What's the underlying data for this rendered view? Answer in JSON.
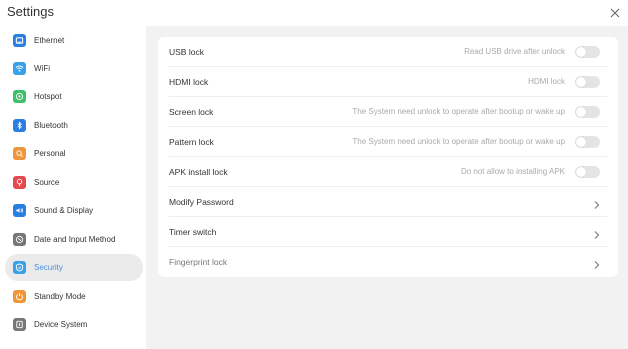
{
  "window": {
    "title": "Settings"
  },
  "colors": {
    "accent": "#4a90d9",
    "toggle_off": "#e4e4e4",
    "panel_bg": "#f2f2f2"
  },
  "sidebar": {
    "items": [
      {
        "label": "Ethernet",
        "icon": "ethernet-icon",
        "color": "#2a7de1"
      },
      {
        "label": "WiFi",
        "icon": "wifi-icon",
        "color": "#3aa0e8"
      },
      {
        "label": "Hotspot",
        "icon": "hotspot-icon",
        "color": "#3fbf6a"
      },
      {
        "label": "Bluetooth",
        "icon": "bluetooth-icon",
        "color": "#2a7de1"
      },
      {
        "label": "Personal",
        "icon": "personal-icon",
        "color": "#f0963a"
      },
      {
        "label": "Source",
        "icon": "source-icon",
        "color": "#e5484d"
      },
      {
        "label": "Sound & Display",
        "icon": "sound-display-icon",
        "color": "#2a7de1"
      },
      {
        "label": "Date and Input Method",
        "icon": "date-input-icon",
        "color": "#777777"
      },
      {
        "label": "Security",
        "icon": "security-icon",
        "color": "#3aa0e8",
        "active": true
      },
      {
        "label": "Standby Mode",
        "icon": "standby-icon",
        "color": "#f0963a"
      },
      {
        "label": "Device System",
        "icon": "device-system-icon",
        "color": "#777777"
      }
    ]
  },
  "security": {
    "rows": [
      {
        "label": "USB lock",
        "hint": "Read USB drive after unlock",
        "control": "toggle",
        "on": false
      },
      {
        "label": "HDMI lock",
        "hint": "HDMI lock",
        "control": "toggle",
        "on": false
      },
      {
        "label": "Screen lock",
        "hint": "The System need unlock to operate after bootup or wake up",
        "control": "toggle",
        "on": false
      },
      {
        "label": "Pattern lock",
        "hint": "The System need unlock to operate after bootup or wake up",
        "control": "toggle",
        "on": false
      },
      {
        "label": "APK install lock",
        "hint": "Do not allow to installing APK",
        "control": "toggle",
        "on": false
      },
      {
        "label": "Modify Password",
        "hint": "",
        "control": "chevron"
      },
      {
        "label": "Timer switch",
        "hint": "",
        "control": "chevron"
      },
      {
        "label": "Fingerprint lock",
        "hint": "",
        "control": "chevron",
        "dim": true
      }
    ]
  }
}
